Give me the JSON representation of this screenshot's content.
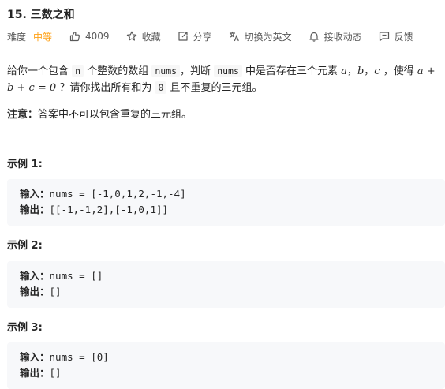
{
  "problem": {
    "title": "15. 三数之和",
    "difficulty_label": "难度",
    "difficulty_value": "中等",
    "likes": "4009",
    "favorite_label": "收藏",
    "share_label": "分享",
    "switch_lang_label": "切换为英文",
    "notify_label": "接收动态",
    "feedback_label": "反馈"
  },
  "description": {
    "p1_a": "给你一个包含 ",
    "p1_code_n": "n",
    "p1_b": " 个整数的数组 ",
    "p1_code_nums": "nums",
    "p1_c": "，判断 ",
    "p1_code_nums2": "nums",
    "p1_d": " 中是否存在三个元素 ",
    "var_a": "a",
    "sep1": "，",
    "var_b": "b",
    "sep2": "，",
    "var_c": "c",
    "p1_e": " ，使得 ",
    "expr": "a + b + c = 0",
    "p1_f": " ？请你找出所有和为 ",
    "p1_code_zero": "0",
    "p1_g": " 且不重复的三元组。",
    "note_label": "注意：",
    "note_text": "答案中不可以包含重复的三元组。"
  },
  "examples": [
    {
      "title": "示例 1:",
      "input_label": "输入：",
      "input_value": "nums = [-1,0,1,2,-1,-4]",
      "output_label": "输出：",
      "output_value": "[[-1,-1,2],[-1,0,1]]"
    },
    {
      "title": "示例 2:",
      "input_label": "输入：",
      "input_value": "nums = []",
      "output_label": "输出：",
      "output_value": "[]"
    },
    {
      "title": "示例 3:",
      "input_label": "输入：",
      "input_value": "nums = [0]",
      "output_label": "输出：",
      "output_value": "[]"
    }
  ],
  "icons": {
    "like": "thumbs-up-icon",
    "favorite": "star-icon",
    "share": "share-icon",
    "translate": "translate-icon",
    "notify": "bell-icon",
    "feedback": "feedback-icon"
  },
  "colors": {
    "difficulty_medium": "#ffa116",
    "example_bg": "#f7f8fa"
  }
}
